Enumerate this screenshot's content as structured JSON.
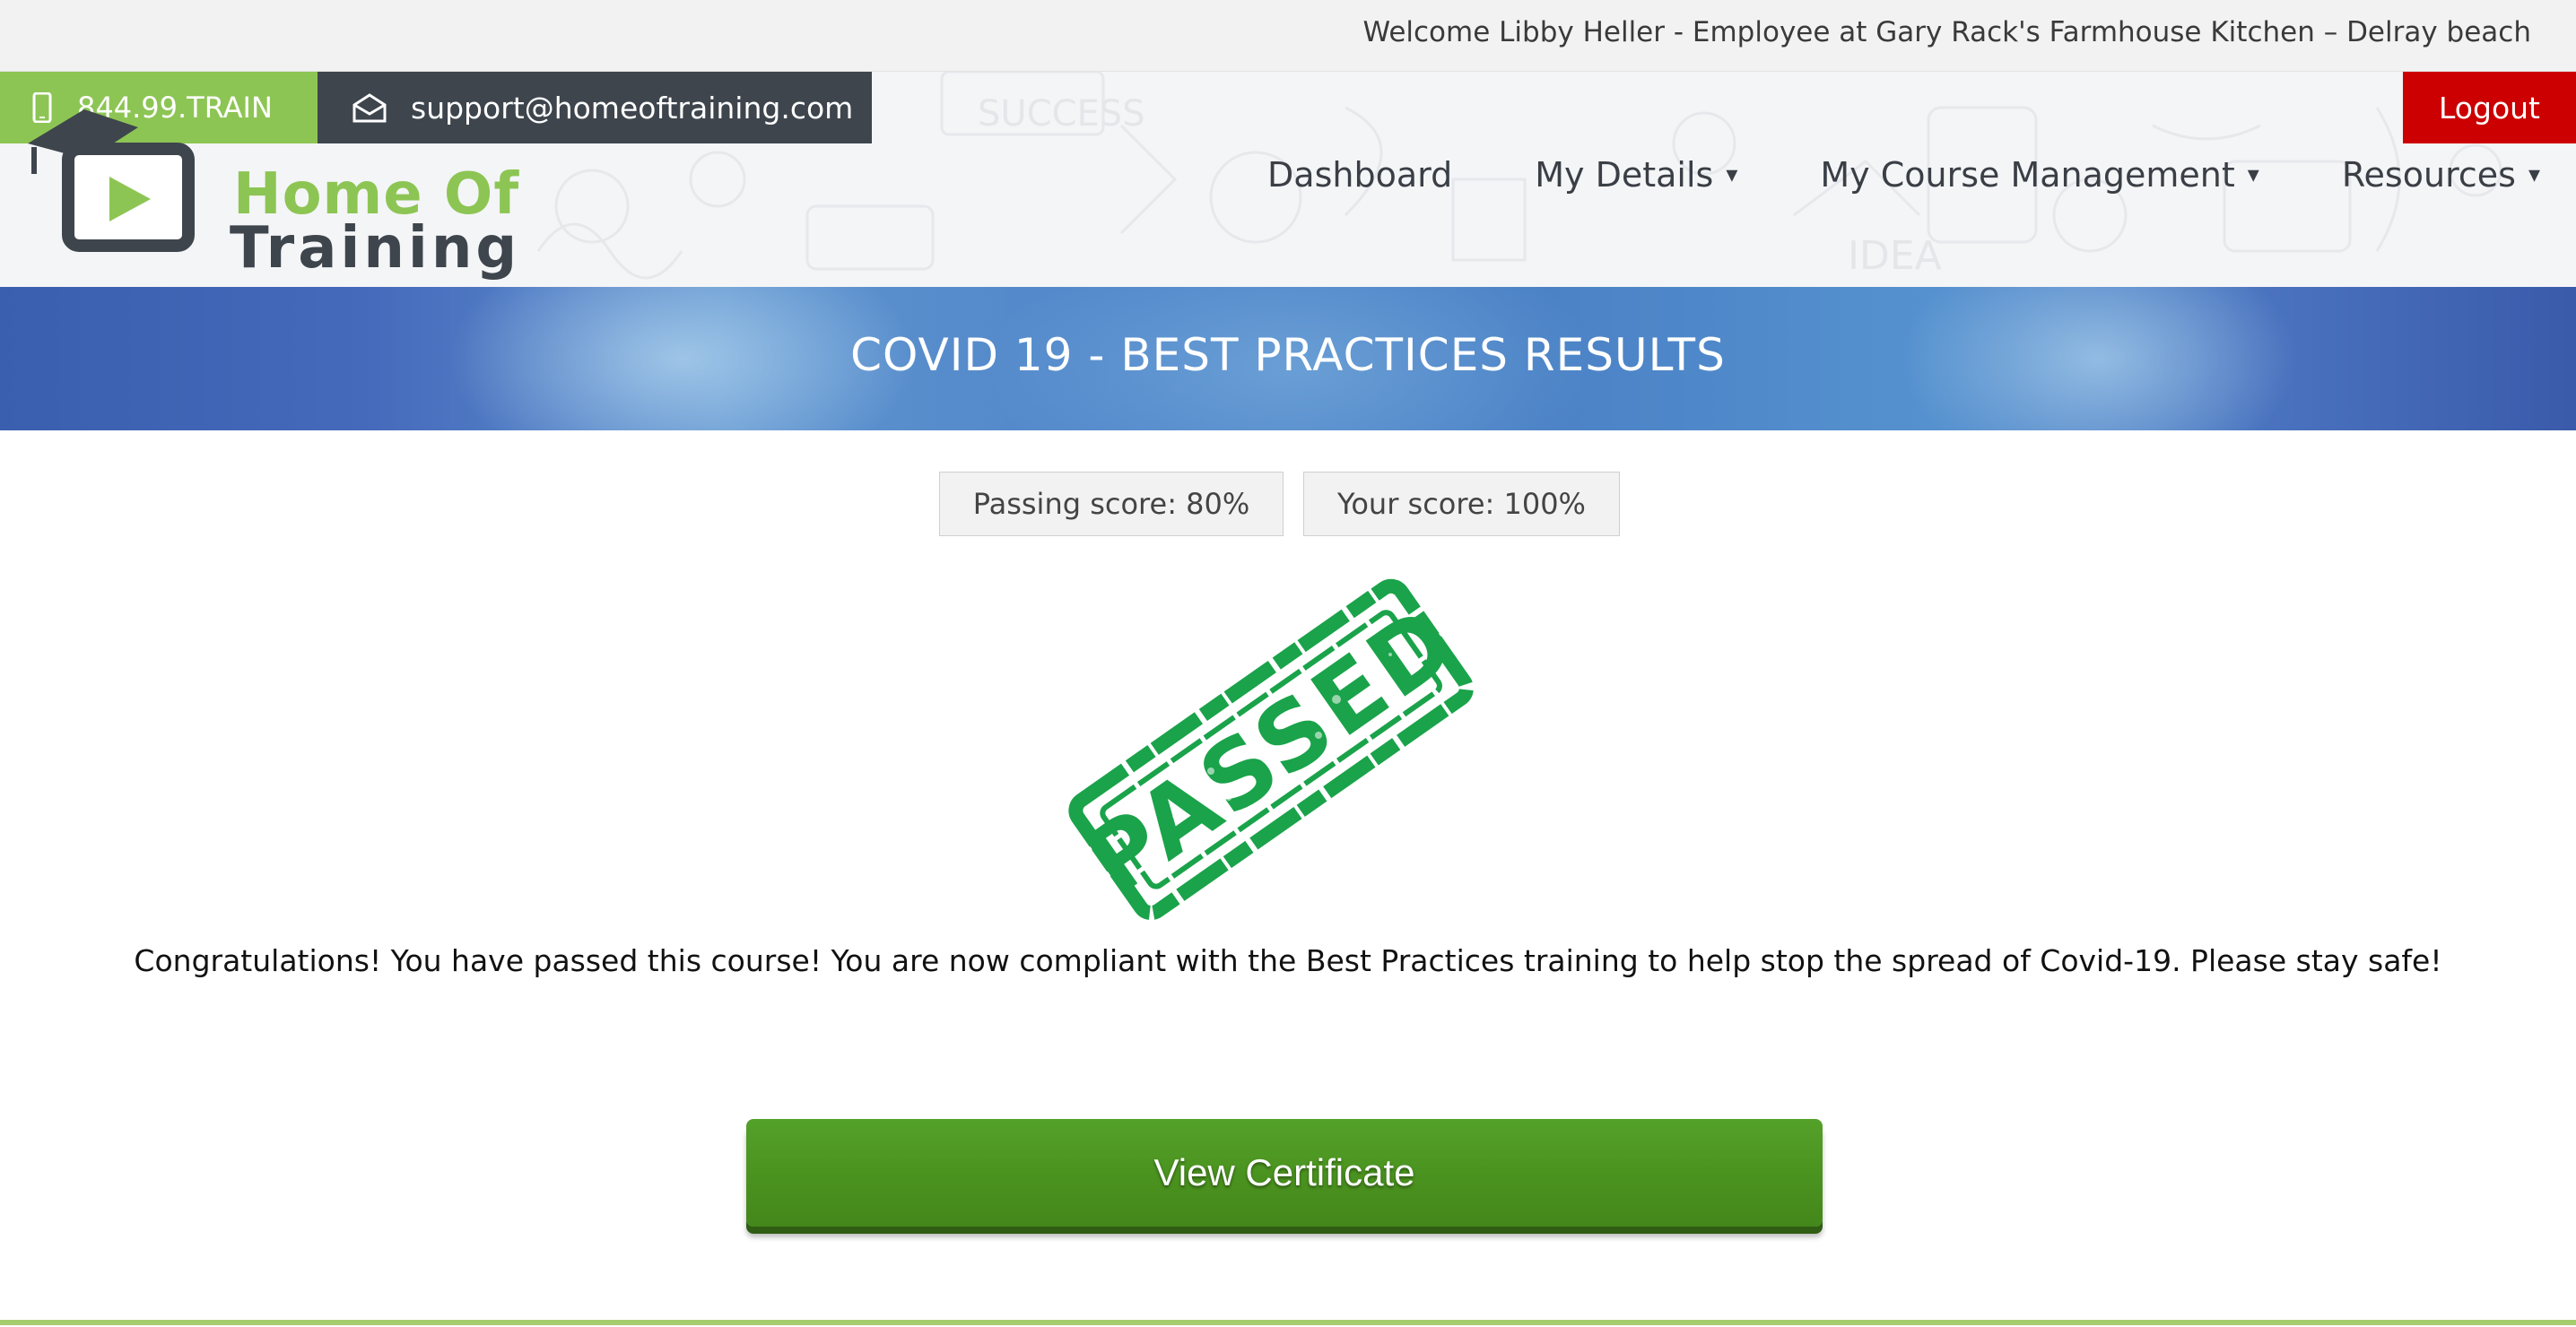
{
  "welcome": {
    "text": "Welcome Libby Heller - Employee at Gary Rack's Farmhouse Kitchen – Delray beach"
  },
  "contact": {
    "phone": "844.99.TRAIN",
    "email": "support@homeoftraining.com",
    "phone_icon": "mobile-phone-icon",
    "email_icon": "envelope-icon"
  },
  "header": {
    "logout_label": "Logout",
    "logo": {
      "line1": "Home Of",
      "line2": "Training"
    },
    "nav": [
      {
        "label": "Dashboard",
        "has_dropdown": false
      },
      {
        "label": "My Details",
        "has_dropdown": true
      },
      {
        "label": "My Course Management",
        "has_dropdown": true
      },
      {
        "label": "Resources",
        "has_dropdown": true
      }
    ],
    "caret": "▾"
  },
  "banner": {
    "title": "COVID 19 - BEST PRACTICES RESULTS"
  },
  "scores": {
    "passing": "Passing score: 80%",
    "yours": "Your score: 100%"
  },
  "stamp": {
    "text": "PASSED"
  },
  "message": "Congratulations! You have passed this course! You are now compliant with the Best Practices training to help stop the spread of Covid-19. Please stay safe!",
  "actions": {
    "view_certificate": "View Certificate"
  },
  "colors": {
    "brand_green": "#8dc554",
    "brand_dark": "#3e454d",
    "logout_red": "#cc0000",
    "banner_blue": "#4a78c2",
    "stamp_green": "#1aa34a",
    "button_green": "#4a921f"
  }
}
